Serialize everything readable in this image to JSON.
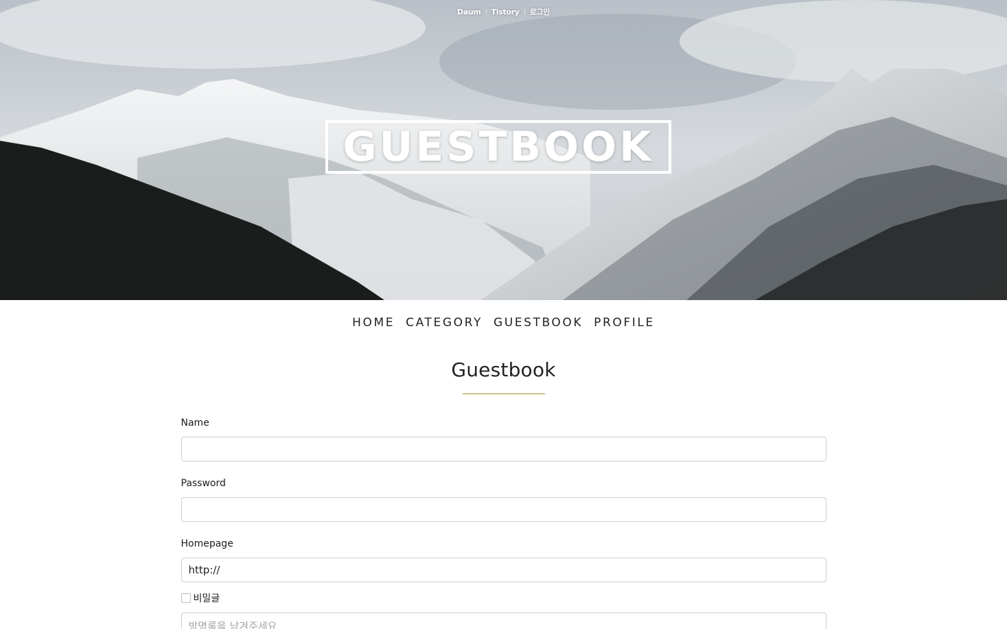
{
  "topbar": {
    "links": [
      "Daum",
      "Tistory",
      "로그인"
    ]
  },
  "hero": {
    "title": "GUESTBOOK"
  },
  "nav": {
    "items": [
      "HOME",
      "CATEGORY",
      "GUESTBOOK",
      "PROFILE"
    ]
  },
  "page": {
    "title": "Guestbook"
  },
  "form": {
    "name_label": "Name",
    "name_value": "",
    "password_label": "Password",
    "password_value": "",
    "homepage_label": "Homepage",
    "homepage_value": "http://",
    "secret_label": "비밀글",
    "secret_checked": false,
    "message_placeholder": "방명록을 남겨주세요"
  },
  "colors": {
    "accent_rule": "#b08a2c",
    "input_border": "#cfcfcf"
  }
}
